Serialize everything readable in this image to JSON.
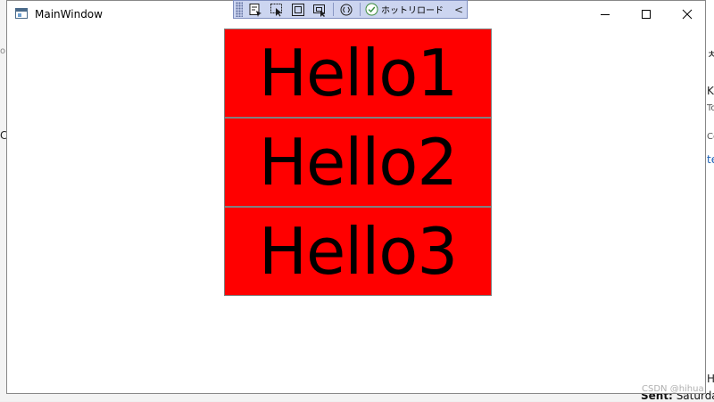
{
  "window": {
    "title": "MainWindow",
    "minimize_icon": "minimize-icon",
    "maximize_icon": "maximize-icon",
    "close_icon": "close-icon"
  },
  "toolbar": {
    "items": [
      "select-element-icon",
      "pointer-icon",
      "layout-adorner-icon",
      "track-focus-icon",
      "display-xaml-icon",
      "hot-reload-check-icon"
    ],
    "hot_reload_label": "ホットリロード",
    "collapse_glyph": "<"
  },
  "content": {
    "cell_color": "#ff0000",
    "border_color": "#808080",
    "cells": [
      "Hello1",
      "Hello2",
      "Hello3"
    ]
  },
  "background": {
    "fragments": [
      "o",
      "o",
      "C",
      "te",
      "ㅊ",
      "Ke",
      "To",
      "Co"
    ],
    "sent_label": "Sent:",
    "sent_value": "Saturda",
    "hi_fragment": "Hi"
  },
  "watermark": "CSDN @hihua"
}
